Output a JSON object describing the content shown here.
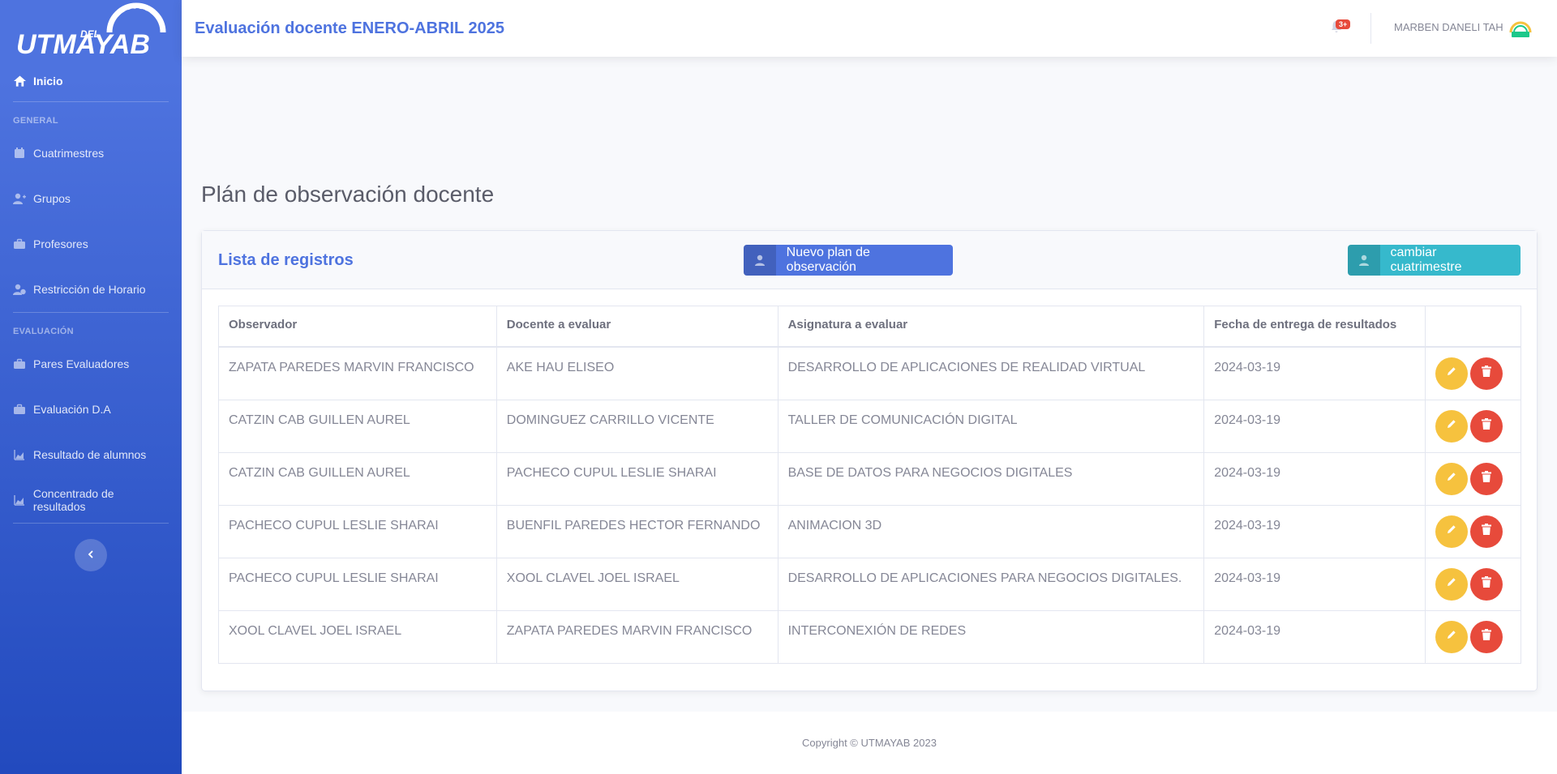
{
  "brand": {
    "logo_text": "UTMAYAB",
    "logo_sub": "DEL"
  },
  "sidebar": {
    "home_label": "Inicio",
    "section_general": "General",
    "general_items": [
      {
        "label": "Cuatrimestres",
        "icon": "calendar-icon"
      },
      {
        "label": "Grupos",
        "icon": "user-plus-icon"
      },
      {
        "label": "Profesores",
        "icon": "briefcase-icon"
      },
      {
        "label": "Restricción de Horario",
        "icon": "user-clock-icon"
      }
    ],
    "section_evaluacion": "Evaluación",
    "eval_items": [
      {
        "label": "Pares Evaluadores",
        "icon": "briefcase-icon"
      },
      {
        "label": "Evaluación D.A",
        "icon": "briefcase-icon"
      },
      {
        "label": "Resultado de alumnos",
        "icon": "chart-area-icon"
      },
      {
        "label": "Concentrado de resultados",
        "icon": "chart-area-icon"
      }
    ]
  },
  "topbar": {
    "title": "Evaluación docente ENERO-ABRIL 2025",
    "alerts_badge": "3+",
    "user_name": "MARBEN DANELI TAH"
  },
  "main": {
    "page_title": "Plán de observación docente",
    "card_title": "Lista de registros",
    "new_button": "Nuevo plan de observación",
    "change_button": "cambiar cuatrimestre",
    "columns": [
      "Observador",
      "Docente a evaluar",
      "Asignatura a evaluar",
      "Fecha de entrega de resultados",
      ""
    ],
    "rows": [
      [
        "ZAPATA PAREDES MARVIN FRANCISCO",
        "AKE HAU ELISEO",
        "DESARROLLO DE APLICACIONES DE REALIDAD VIRTUAL",
        "2024-03-19"
      ],
      [
        "CATZIN CAB GUILLEN AUREL",
        "DOMINGUEZ CARRILLO VICENTE",
        "TALLER DE COMUNICACIÓN DIGITAL",
        "2024-03-19"
      ],
      [
        "CATZIN CAB GUILLEN AUREL",
        "PACHECO CUPUL LESLIE SHARAI",
        "BASE DE DATOS PARA NEGOCIOS DIGITALES",
        "2024-03-19"
      ],
      [
        "PACHECO CUPUL LESLIE SHARAI",
        "BUENFIL PAREDES HECTOR FERNANDO",
        "ANIMACION 3D",
        "2024-03-19"
      ],
      [
        "PACHECO CUPUL LESLIE SHARAI",
        "XOOL CLAVEL JOEL ISRAEL",
        "DESARROLLO DE APLICACIONES PARA NEGOCIOS DIGITALES.",
        "2024-03-19"
      ],
      [
        "XOOL CLAVEL JOEL ISRAEL",
        "ZAPATA PAREDES MARVIN FRANCISCO",
        "INTERCONEXIÓN DE REDES",
        "2024-03-19"
      ]
    ]
  },
  "footer": {
    "copyright": "Copyright © UTMAYAB 2023"
  },
  "colors": {
    "primary": "#4e73df",
    "info": "#36b9cc",
    "warning": "#f6c23e",
    "danger": "#e74a3b"
  }
}
